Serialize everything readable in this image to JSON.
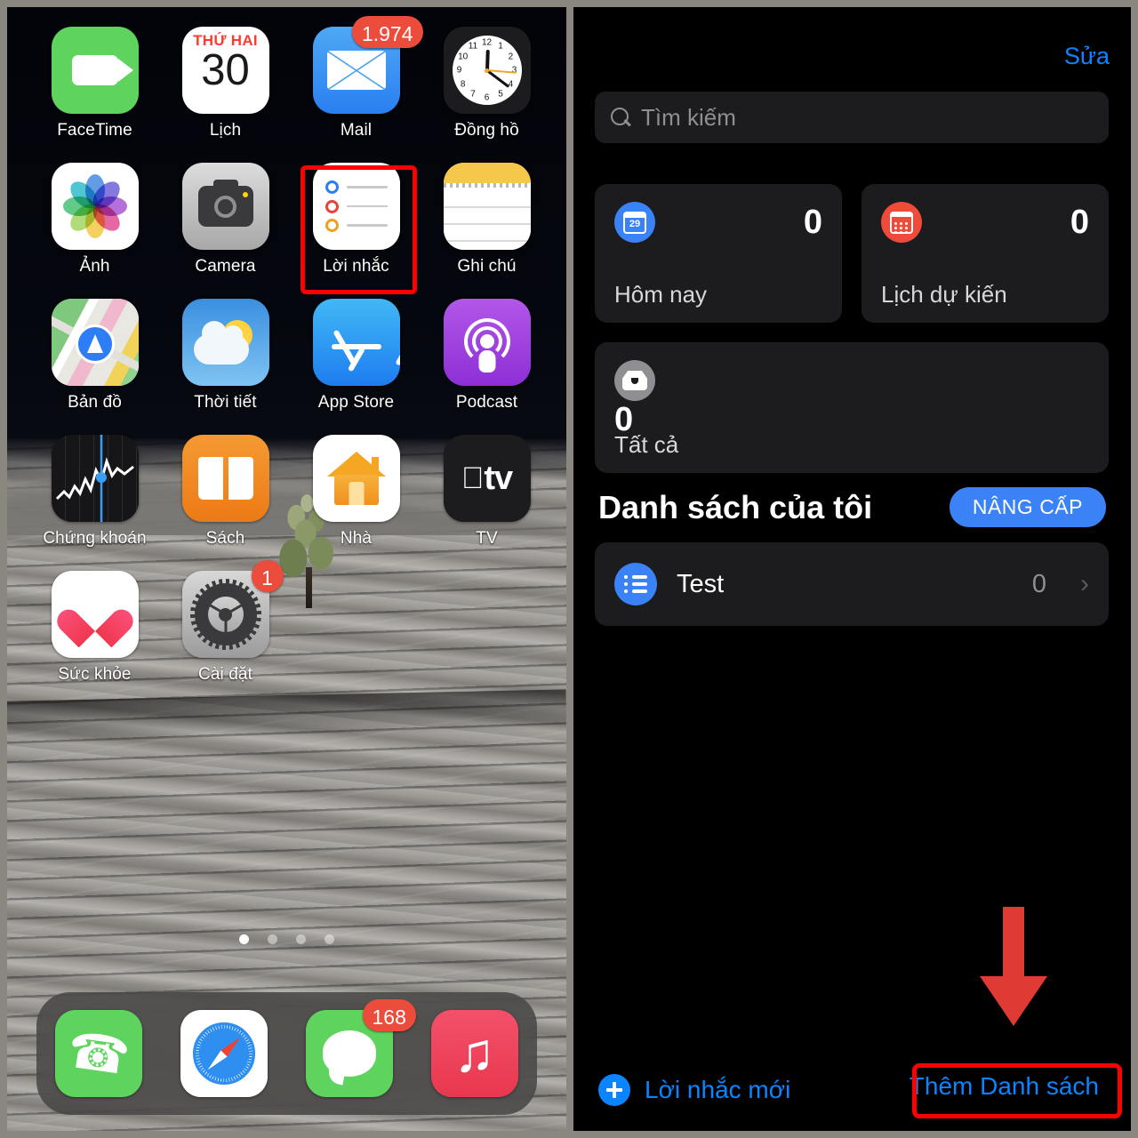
{
  "home_screen": {
    "rows": [
      [
        {
          "label": "FaceTime",
          "icon": "facetime-icon",
          "badge": null
        },
        {
          "label": "Lịch",
          "icon": "calendar-icon",
          "badge": null,
          "calendar": {
            "weekday": "THỨ HAI",
            "day": "30"
          }
        },
        {
          "label": "Mail",
          "icon": "mail-icon",
          "badge": "1.974"
        },
        {
          "label": "Đồng hồ",
          "icon": "clock-icon",
          "badge": null
        }
      ],
      [
        {
          "label": "Ảnh",
          "icon": "photos-icon",
          "badge": null
        },
        {
          "label": "Camera",
          "icon": "camera-icon",
          "badge": null
        },
        {
          "label": "Lời nhắc",
          "icon": "reminders-icon",
          "badge": null,
          "highlighted": true
        },
        {
          "label": "Ghi chú",
          "icon": "notes-icon",
          "badge": null
        }
      ],
      [
        {
          "label": "Bản đồ",
          "icon": "maps-icon",
          "badge": null
        },
        {
          "label": "Thời tiết",
          "icon": "weather-icon",
          "badge": null
        },
        {
          "label": "App Store",
          "icon": "appstore-icon",
          "badge": null
        },
        {
          "label": "Podcast",
          "icon": "podcast-icon",
          "badge": null
        }
      ],
      [
        {
          "label": "Chứng khoán",
          "icon": "stocks-icon",
          "badge": null
        },
        {
          "label": "Sách",
          "icon": "books-icon",
          "badge": null
        },
        {
          "label": "Nhà",
          "icon": "home-icon",
          "badge": null
        },
        {
          "label": "TV",
          "icon": "tv-icon",
          "badge": null
        }
      ],
      [
        {
          "label": "Sức khỏe",
          "icon": "health-icon",
          "badge": null
        },
        {
          "label": "Cài đặt",
          "icon": "settings-icon",
          "badge": "1"
        }
      ]
    ],
    "page_dots": {
      "total": 4,
      "active_index": 0
    },
    "dock": [
      {
        "label": "Phone",
        "icon": "phone-icon",
        "badge": null
      },
      {
        "label": "Safari",
        "icon": "safari-icon",
        "badge": null
      },
      {
        "label": "Messages",
        "icon": "messages-icon",
        "badge": "168"
      },
      {
        "label": "Music",
        "icon": "music-icon",
        "badge": null
      }
    ]
  },
  "reminders": {
    "edit_label": "Sửa",
    "search": {
      "placeholder": "Tìm kiếm",
      "icon": "search-icon"
    },
    "smart_lists": [
      {
        "name": "Hôm nay",
        "count": "0",
        "icon": "today-calendar-icon",
        "color": "#3b82f6"
      },
      {
        "name": "Lịch dự kiến",
        "count": "0",
        "icon": "scheduled-calendar-icon",
        "color": "#ef4a3a"
      }
    ],
    "all_card": {
      "name": "Tất cả",
      "count": "0",
      "icon": "inbox-icon",
      "color": "#8e8e93"
    },
    "section": {
      "title": "Danh sách của tôi",
      "upgrade_label": "NÂNG CẤP"
    },
    "lists": [
      {
        "name": "Test",
        "count": "0",
        "icon": "list-bullet-icon",
        "chevron": "›",
        "color": "#3b82f6"
      }
    ],
    "bottom": {
      "new_reminder_label": "Lời nhắc mới",
      "new_reminder_icon": "plus-circle-icon",
      "add_list_label": "Thêm Danh sách"
    },
    "annotations": {
      "arrow_icon": "down-arrow-annotation",
      "highlight_color": "#ff0000"
    }
  },
  "calendar_icon_day": "29",
  "clock_time": {
    "hour": 12,
    "minute": 21
  }
}
